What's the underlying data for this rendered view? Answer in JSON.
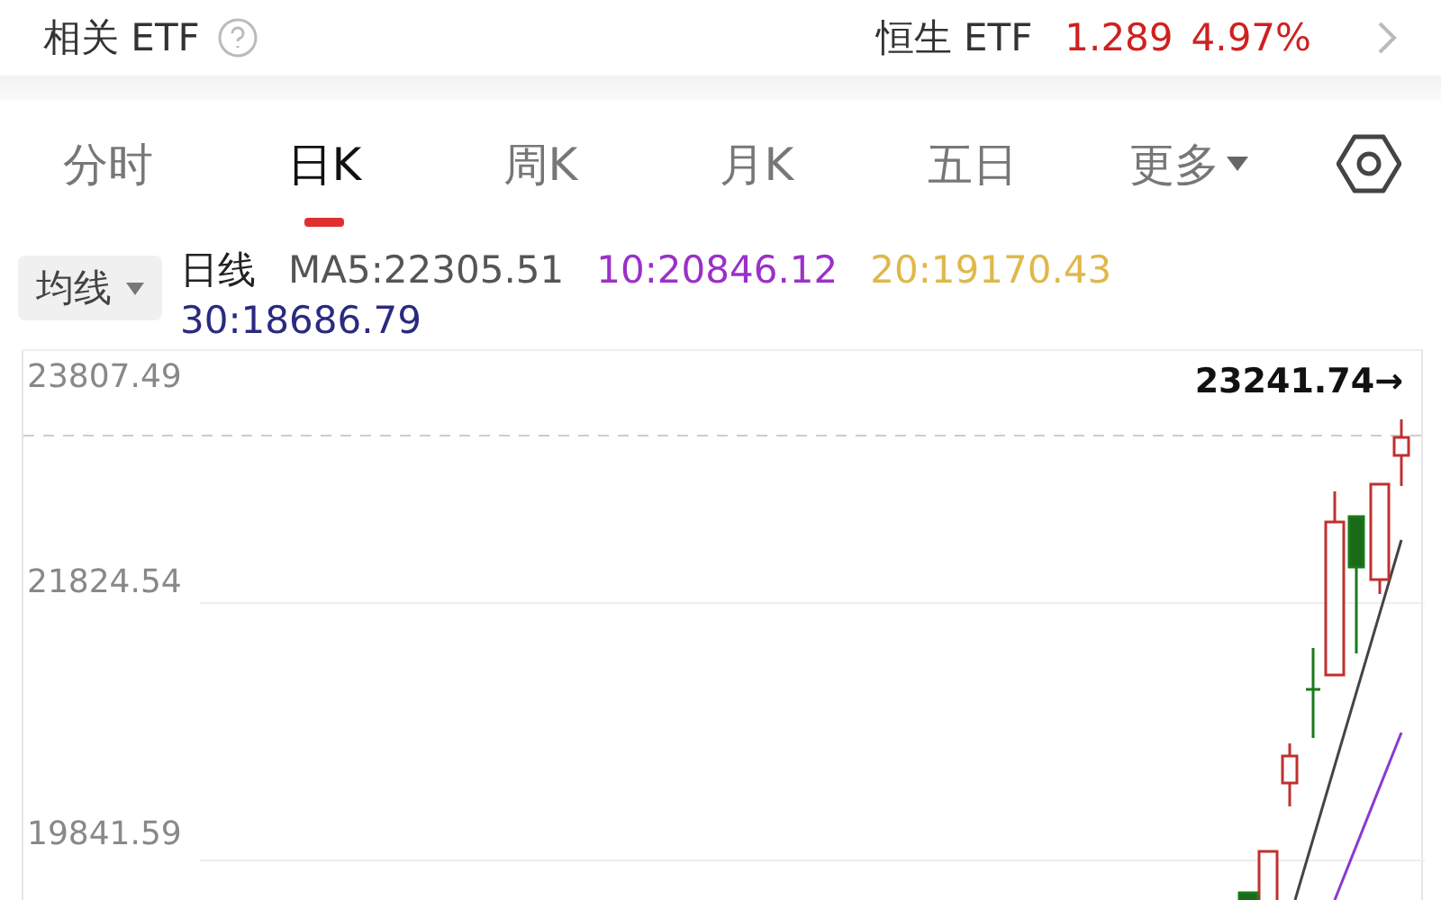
{
  "header": {
    "title": "相关 ETF",
    "etf_name": "恒生 ETF",
    "price": "1.289",
    "change": "4.97%"
  },
  "tabs": [
    {
      "label": "分时",
      "selected": false,
      "kind": "tab"
    },
    {
      "label": "日K",
      "selected": true,
      "kind": "tab"
    },
    {
      "label": "周K",
      "selected": false,
      "kind": "tab"
    },
    {
      "label": "月K",
      "selected": false,
      "kind": "tab"
    },
    {
      "label": "五日",
      "selected": false,
      "kind": "tab"
    },
    {
      "label": "更多",
      "selected": false,
      "kind": "dropdown"
    }
  ],
  "ma_selector": {
    "label": "均线"
  },
  "legend": {
    "title": "日线",
    "items": [
      {
        "text": "MA5:22305.51",
        "color": "#555555"
      },
      {
        "text": "10:20846.12",
        "color": "#9b30c8"
      },
      {
        "text": "20:19170.43",
        "color": "#e0b84a"
      },
      {
        "text": "30:18686.79",
        "color": "#2a2a80"
      }
    ]
  },
  "chart": {
    "y_labels": [
      "23807.49",
      "21824.54",
      "19841.59"
    ],
    "last_price": "23241.74→"
  }
}
